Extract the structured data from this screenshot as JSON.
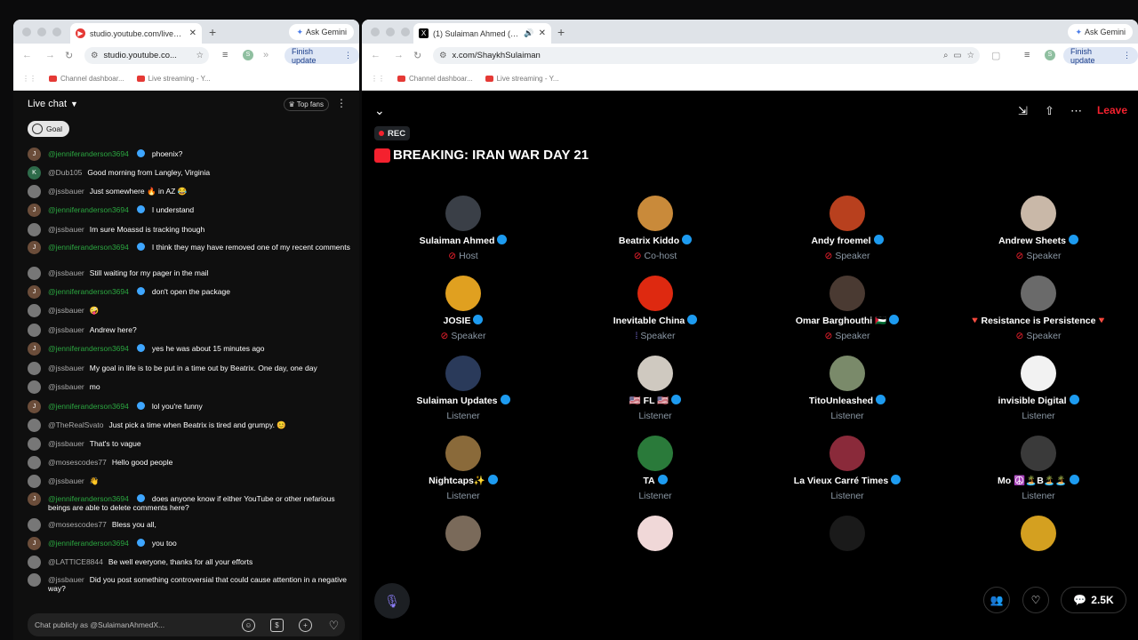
{
  "left": {
    "tab_title": "studio.youtube.com/live_chat",
    "gemini": "Ask Gemini",
    "url": "studio.youtube.co...",
    "finish_update": "Finish update",
    "bookmarks": [
      "Channel dashboar...",
      "Live streaming - Y..."
    ],
    "chat_title": "Live chat",
    "top_fans": "Top fans",
    "goal": "Goal",
    "input_placeholder": "Chat publicly as @SulaimanAhmedX...",
    "messages": [
      {
        "avatar": "J",
        "user": "@jenniferanderson3694",
        "green": true,
        "text": "phoenix?"
      },
      {
        "avatar": "K",
        "user": "@Dub105",
        "green": false,
        "text": "Good morning from Langley, Virginia"
      },
      {
        "avatar": "",
        "user": "@jssbauer",
        "green": false,
        "text": "Just somewhere 🔥 in AZ 😂"
      },
      {
        "avatar": "J",
        "user": "@jenniferanderson3694",
        "green": true,
        "text": "I understand"
      },
      {
        "avatar": "",
        "user": "@jssbauer",
        "green": false,
        "text": "Im sure Moassd is tracking though"
      },
      {
        "avatar": "J",
        "user": "@jenniferanderson3694",
        "green": true,
        "text": "I think they may have removed one of my recent comments"
      },
      {
        "avatar": "",
        "user": "@jssbauer",
        "green": false,
        "text": "Still waiting for my pager in the mail"
      },
      {
        "avatar": "J",
        "user": "@jenniferanderson3694",
        "green": true,
        "text": "don't open the package"
      },
      {
        "avatar": "",
        "user": "@jssbauer",
        "green": false,
        "text": "🤪"
      },
      {
        "avatar": "",
        "user": "@jssbauer",
        "green": false,
        "text": "Andrew here?"
      },
      {
        "avatar": "J",
        "user": "@jenniferanderson3694",
        "green": true,
        "text": "yes he was about 15 minutes ago"
      },
      {
        "avatar": "",
        "user": "@jssbauer",
        "green": false,
        "text": "My goal in life is to be put in a time out by Beatrix. One day, one day"
      },
      {
        "avatar": "",
        "user": "@jssbauer",
        "green": false,
        "text": "mo"
      },
      {
        "avatar": "J",
        "user": "@jenniferanderson3694",
        "green": true,
        "text": "lol you're funny"
      },
      {
        "avatar": "",
        "user": "@TheRealSvato",
        "green": false,
        "text": "Just pick a time when Beatrix is tired and grumpy. 😊"
      },
      {
        "avatar": "",
        "user": "@jssbauer",
        "green": false,
        "text": "That's to vague"
      },
      {
        "avatar": "",
        "user": "@mosescodes77",
        "green": false,
        "text": "Hello good people"
      },
      {
        "avatar": "",
        "user": "@jssbauer",
        "green": false,
        "text": "👋"
      },
      {
        "avatar": "J",
        "user": "@jenniferanderson3694",
        "green": true,
        "text": "does anyone know if either YouTube or other nefarious beings are able to delete comments here?"
      },
      {
        "avatar": "",
        "user": "@mosescodes77",
        "green": false,
        "text": "Bless you all,"
      },
      {
        "avatar": "J",
        "user": "@jenniferanderson3694",
        "green": true,
        "text": "you too"
      },
      {
        "avatar": "",
        "user": "@LATTICE8844",
        "green": false,
        "text": "Be well everyone, thanks for all your efforts"
      },
      {
        "avatar": "",
        "user": "@jssbauer",
        "green": false,
        "text": "Did you post something controversial that could cause attention in a negative way?"
      }
    ]
  },
  "right": {
    "tab_title": "(1) Sulaiman Ahmed (@Sh...",
    "gemini": "Ask Gemini",
    "url": "x.com/ShaykhSulaiman",
    "finish_update": "Finish update",
    "bookmarks": [
      "Channel dashboar...",
      "Live streaming - Y..."
    ],
    "leave": "Leave",
    "rec": "REC",
    "space_title": "BREAKING: IRAN WAR DAY 21",
    "reply_count": "2.5K",
    "participants": [
      {
        "name": "Sulaiman Ahmed",
        "role": "Host",
        "verified": true,
        "color": "#3a3f47"
      },
      {
        "name": "Beatrix Kiddo",
        "role": "Co-host",
        "verified": true,
        "color": "#c98a3a"
      },
      {
        "name": "Andy froemel",
        "role": "Speaker",
        "verified": true,
        "color": "#b8401e"
      },
      {
        "name": "Andrew Sheets",
        "role": "Speaker",
        "verified": true,
        "color": "#c9b8a8"
      },
      {
        "name": "JOSIE",
        "role": "Speaker",
        "verified": true,
        "color": "#e0a020"
      },
      {
        "name": "Inevitable China",
        "role": "Speaker",
        "verified": true,
        "color": "#de2910"
      },
      {
        "name": "Omar Barghouthi 🇵🇸",
        "role": "Speaker",
        "verified": true,
        "color": "#4a3a32"
      },
      {
        "name": "🔻Resistance is Persistence🔻",
        "role": "Speaker",
        "verified": false,
        "color": "#6a6a6a"
      },
      {
        "name": "Sulaiman Updates",
        "role": "Listener",
        "verified": true,
        "color": "#2a3a5a"
      },
      {
        "name": "🇺🇸 FL 🇺🇸",
        "role": "Listener",
        "verified": true,
        "color": "#cfc9c0"
      },
      {
        "name": "TitoUnleashed",
        "role": "Listener",
        "verified": true,
        "color": "#7a8a6a"
      },
      {
        "name": "invisible Digital",
        "role": "Listener",
        "verified": true,
        "color": "#f2f2f2"
      },
      {
        "name": "Nightcaps✨",
        "role": "Listener",
        "verified": true,
        "color": "#8a6a3a"
      },
      {
        "name": "TA",
        "role": "Listener",
        "verified": true,
        "color": "#2a7a3a"
      },
      {
        "name": "La Vieux Carré Times",
        "role": "Listener",
        "verified": true,
        "color": "#8a2a3a"
      },
      {
        "name": "Mo ☮️🏝️B🏝️🏝️",
        "role": "Listener",
        "verified": true,
        "color": "#3a3a3a"
      },
      {
        "name": "",
        "role": "",
        "verified": false,
        "color": "#7a6a5a"
      },
      {
        "name": "",
        "role": "",
        "verified": false,
        "color": "#f0d8d8"
      },
      {
        "name": "",
        "role": "",
        "verified": false,
        "color": "#1a1a1a"
      },
      {
        "name": "",
        "role": "",
        "verified": false,
        "color": "#d4a020"
      }
    ]
  }
}
